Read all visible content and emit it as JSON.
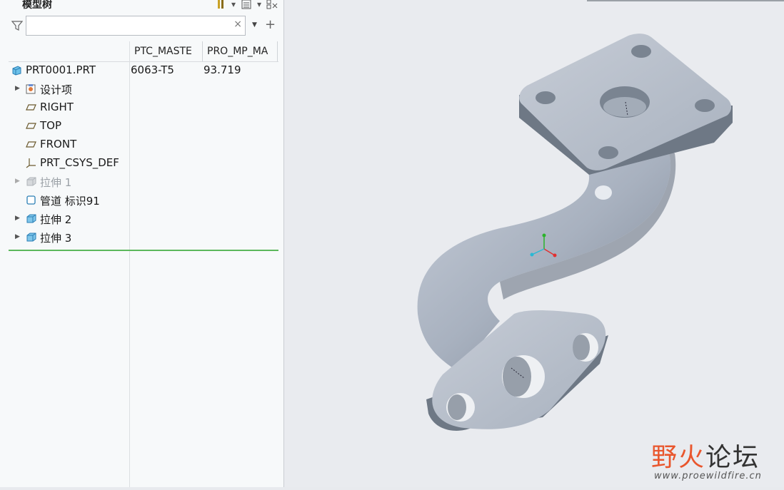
{
  "panel": {
    "title": "模型树",
    "filter_placeholder": "",
    "clear_symbol": "×"
  },
  "columns": [
    {
      "label": "PTC_MASTE"
    },
    {
      "label": "PRO_MP_MA"
    }
  ],
  "tree": {
    "root": {
      "label": "PRT0001.PRT",
      "ptc_master": "6063-T5",
      "pro_mp_mass": "93.719",
      "icon": "part-icon"
    },
    "items": [
      {
        "label": "设计项",
        "icon": "design-items-icon",
        "expandable": true,
        "dim": false
      },
      {
        "label": "RIGHT",
        "icon": "datum-plane-icon",
        "expandable": false,
        "dim": false
      },
      {
        "label": "TOP",
        "icon": "datum-plane-icon",
        "expandable": false,
        "dim": false
      },
      {
        "label": "FRONT",
        "icon": "datum-plane-icon",
        "expandable": false,
        "dim": false
      },
      {
        "label": "PRT_CSYS_DEF",
        "icon": "csys-icon",
        "expandable": false,
        "dim": false
      },
      {
        "label": "拉伸 1",
        "icon": "extrude-icon",
        "expandable": true,
        "dim": true
      },
      {
        "label": "管道 标识91",
        "icon": "pipe-icon",
        "expandable": false,
        "dim": false
      },
      {
        "label": "拉伸 2",
        "icon": "extrude-icon",
        "expandable": true,
        "dim": false
      },
      {
        "label": "拉伸 3",
        "icon": "extrude-icon",
        "expandable": true,
        "dim": false
      }
    ]
  },
  "watermark": {
    "title_part1": "野火",
    "title_part2": "论坛",
    "url": "www.proewildfire.cn"
  },
  "colors": {
    "model_body": "#a8b1bf",
    "model_shadow": "#6e7885",
    "insert_line": "#5cb85c",
    "watermark": "#e9562d"
  }
}
